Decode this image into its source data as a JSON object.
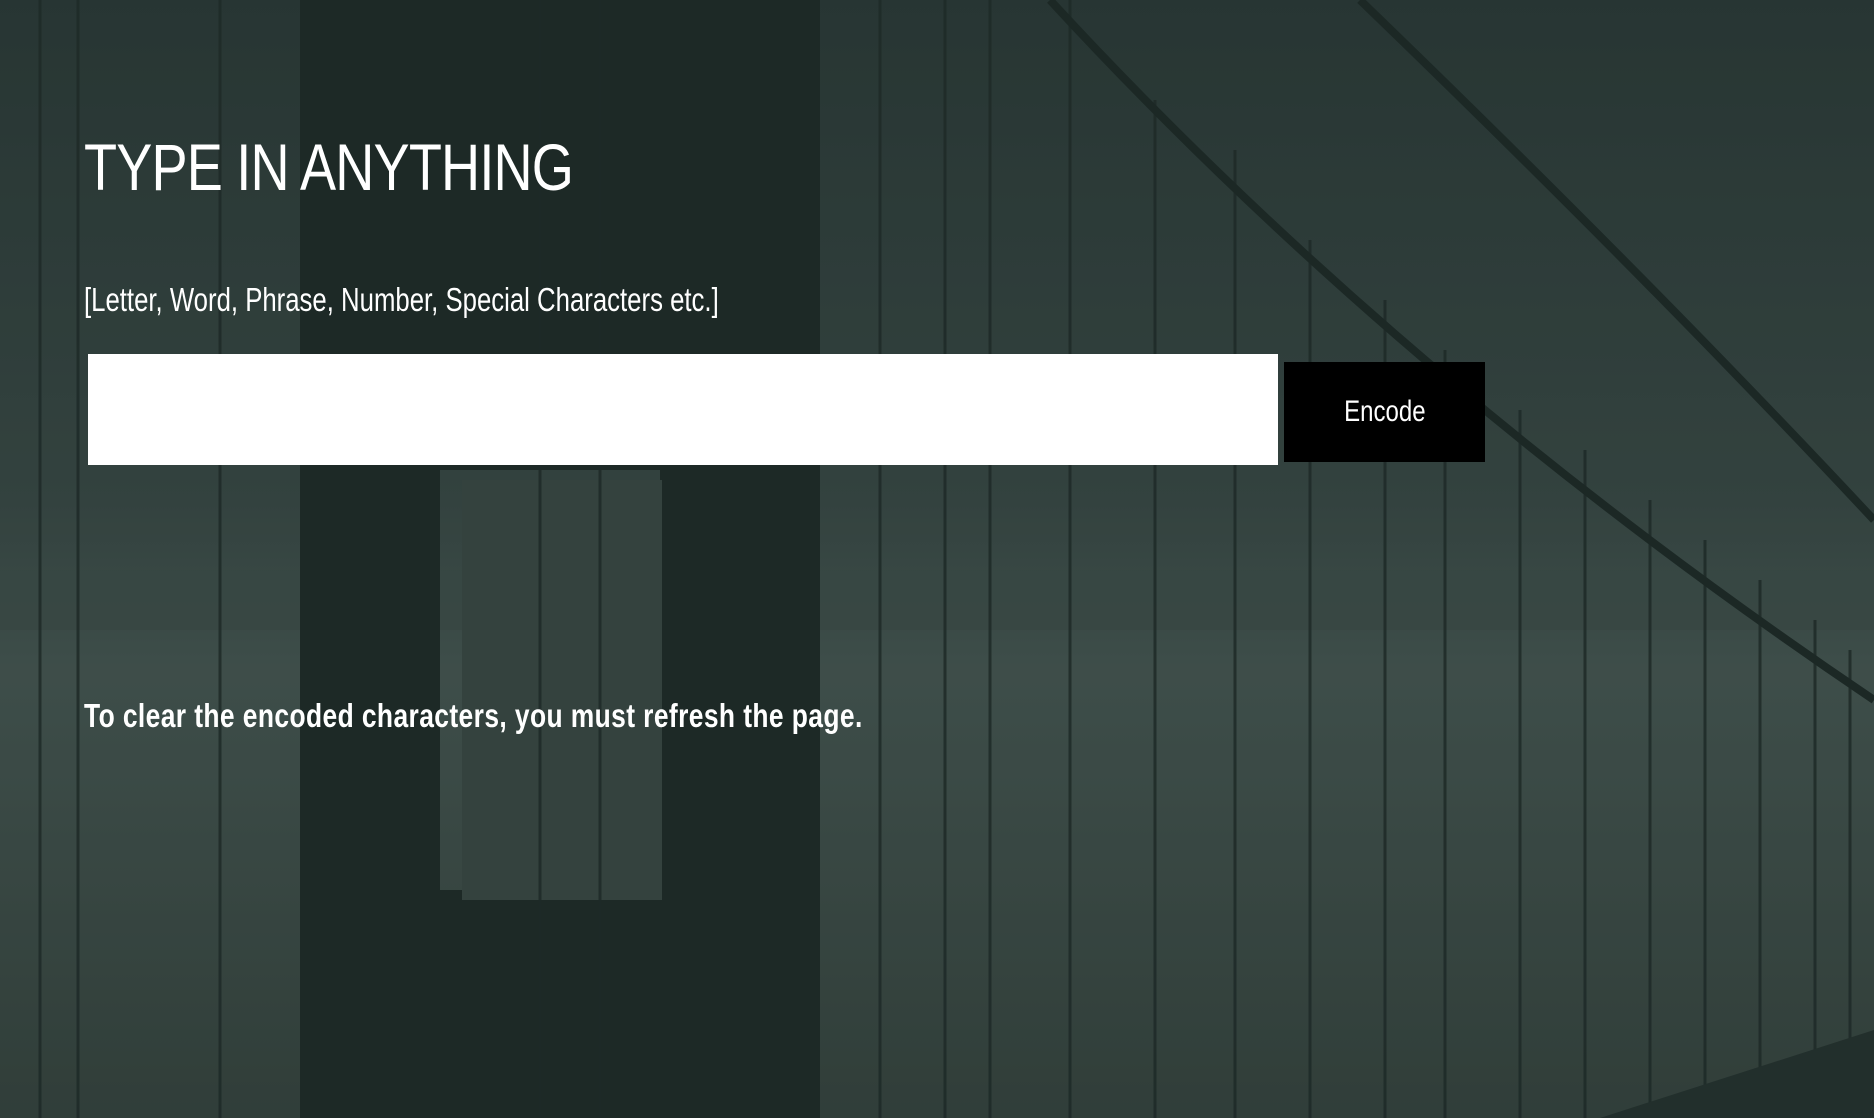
{
  "page": {
    "title": "TYPE IN ANYTHING",
    "subtitle": "[Letter, Word, Phrase, Number, Special Characters etc.]",
    "note": "To clear the encoded characters, you must refresh the page."
  },
  "form": {
    "input_value": "",
    "input_placeholder": "",
    "button_label": "Encode"
  },
  "colors": {
    "overlay": "#2b3a38",
    "button_bg": "#000000",
    "text": "#ffffff"
  }
}
